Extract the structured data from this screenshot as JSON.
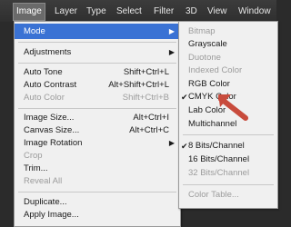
{
  "menubar": {
    "items": [
      "Image",
      "Layer",
      "Type",
      "Select",
      "Filter",
      "3D",
      "View",
      "Window"
    ]
  },
  "image_menu": {
    "items": [
      {
        "label": "Mode",
        "shortcut": "",
        "has_submenu": true,
        "state": "highlighted"
      },
      {
        "label": "Adjustments",
        "shortcut": "",
        "has_submenu": true,
        "state": "enabled"
      },
      {
        "label": "Auto Tone",
        "shortcut": "Shift+Ctrl+L",
        "state": "enabled"
      },
      {
        "label": "Auto Contrast",
        "shortcut": "Alt+Shift+Ctrl+L",
        "state": "enabled"
      },
      {
        "label": "Auto Color",
        "shortcut": "Shift+Ctrl+B",
        "state": "disabled"
      },
      {
        "label": "Image Size...",
        "shortcut": "Alt+Ctrl+I",
        "state": "enabled"
      },
      {
        "label": "Canvas Size...",
        "shortcut": "Alt+Ctrl+C",
        "state": "enabled"
      },
      {
        "label": "Image Rotation",
        "shortcut": "",
        "has_submenu": true,
        "state": "enabled"
      },
      {
        "label": "Crop",
        "shortcut": "",
        "state": "disabled"
      },
      {
        "label": "Trim...",
        "shortcut": "",
        "state": "enabled"
      },
      {
        "label": "Reveal All",
        "shortcut": "",
        "state": "disabled"
      },
      {
        "label": "Duplicate...",
        "shortcut": "",
        "state": "enabled"
      },
      {
        "label": "Apply Image...",
        "shortcut": "",
        "state": "enabled"
      }
    ]
  },
  "mode_submenu": {
    "items": [
      {
        "label": "Bitmap",
        "state": "disabled"
      },
      {
        "label": "Grayscale",
        "state": "enabled"
      },
      {
        "label": "Duotone",
        "state": "disabled"
      },
      {
        "label": "Indexed Color",
        "state": "disabled"
      },
      {
        "label": "RGB Color",
        "state": "enabled"
      },
      {
        "label": "CMYK Color",
        "state": "checked"
      },
      {
        "label": "Lab Color",
        "state": "enabled"
      },
      {
        "label": "Multichannel",
        "state": "enabled"
      },
      {
        "label": "8 Bits/Channel",
        "state": "checked"
      },
      {
        "label": "16 Bits/Channel",
        "state": "enabled"
      },
      {
        "label": "32 Bits/Channel",
        "state": "disabled"
      },
      {
        "label": "Color Table...",
        "state": "disabled"
      }
    ]
  },
  "colors": {
    "highlight": "#3a72d4",
    "annotation_arrow": "#c84b3c"
  },
  "icons": {
    "submenu": "chevron-right-icon",
    "check": "checkmark-icon",
    "pointer": "annotation-arrow-icon"
  }
}
